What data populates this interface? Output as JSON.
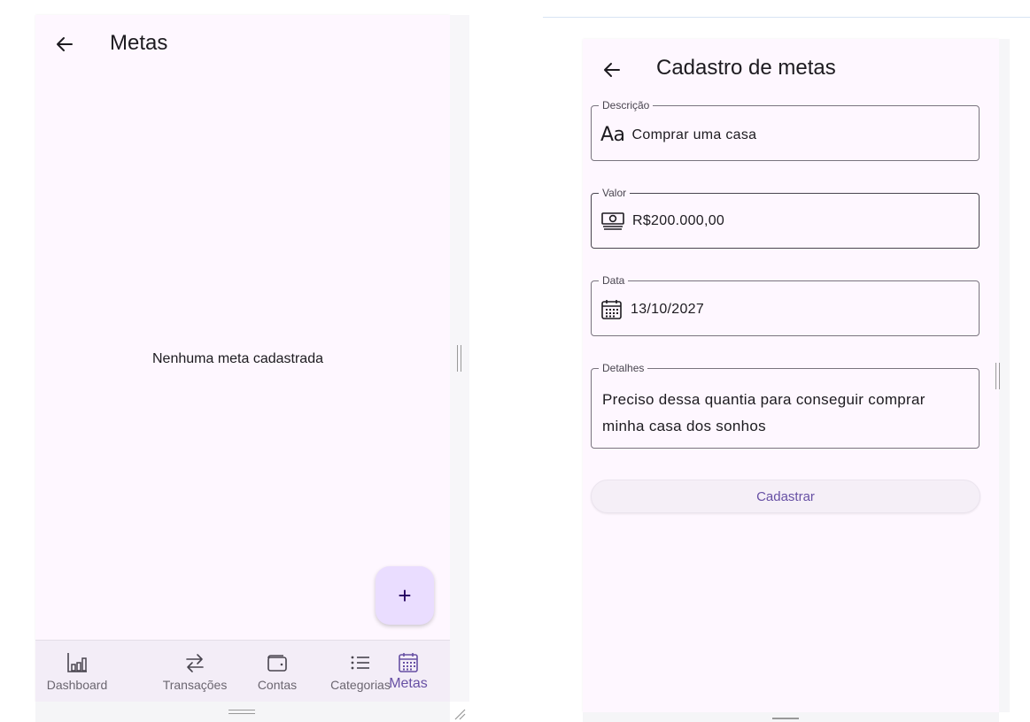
{
  "metas_screen": {
    "title": "Metas",
    "back_icon": "arrow-back-icon",
    "empty_message": "Nenhuma meta cadastrada",
    "fab_label": "+",
    "nav": [
      {
        "label": "Dashboard",
        "icon": "bar-chart-icon",
        "active": false
      },
      {
        "label": "Transações",
        "icon": "swap-arrows-icon",
        "active": false
      },
      {
        "label": "Contas",
        "icon": "wallet-icon",
        "active": false
      },
      {
        "label": "Categorias",
        "icon": "list-icon",
        "active": false
      },
      {
        "label": "Metas",
        "icon": "calendar-icon",
        "active": true
      }
    ]
  },
  "cadastro_screen": {
    "title": "Cadastro de metas",
    "back_icon": "arrow-back-icon",
    "fields": {
      "descricao": {
        "label": "Descrição",
        "icon_text": "Aa",
        "value": "Comprar uma casa"
      },
      "valor": {
        "label": "Valor",
        "icon": "money-icon",
        "value": "R$200.000,00"
      },
      "data": {
        "label": "Data",
        "icon": "calendar-icon",
        "value": "13/10/2027"
      },
      "detalhes": {
        "label": "Detalhes",
        "value": "Preciso dessa quantia para conseguir comprar minha casa dos sonhos"
      }
    },
    "submit_label": "Cadastrar"
  },
  "colors": {
    "surface": "#fef7ff",
    "nav_background": "#f3edf7",
    "primary": "#6750a4",
    "fab_background": "#eaddff",
    "outline": "#79747e"
  }
}
